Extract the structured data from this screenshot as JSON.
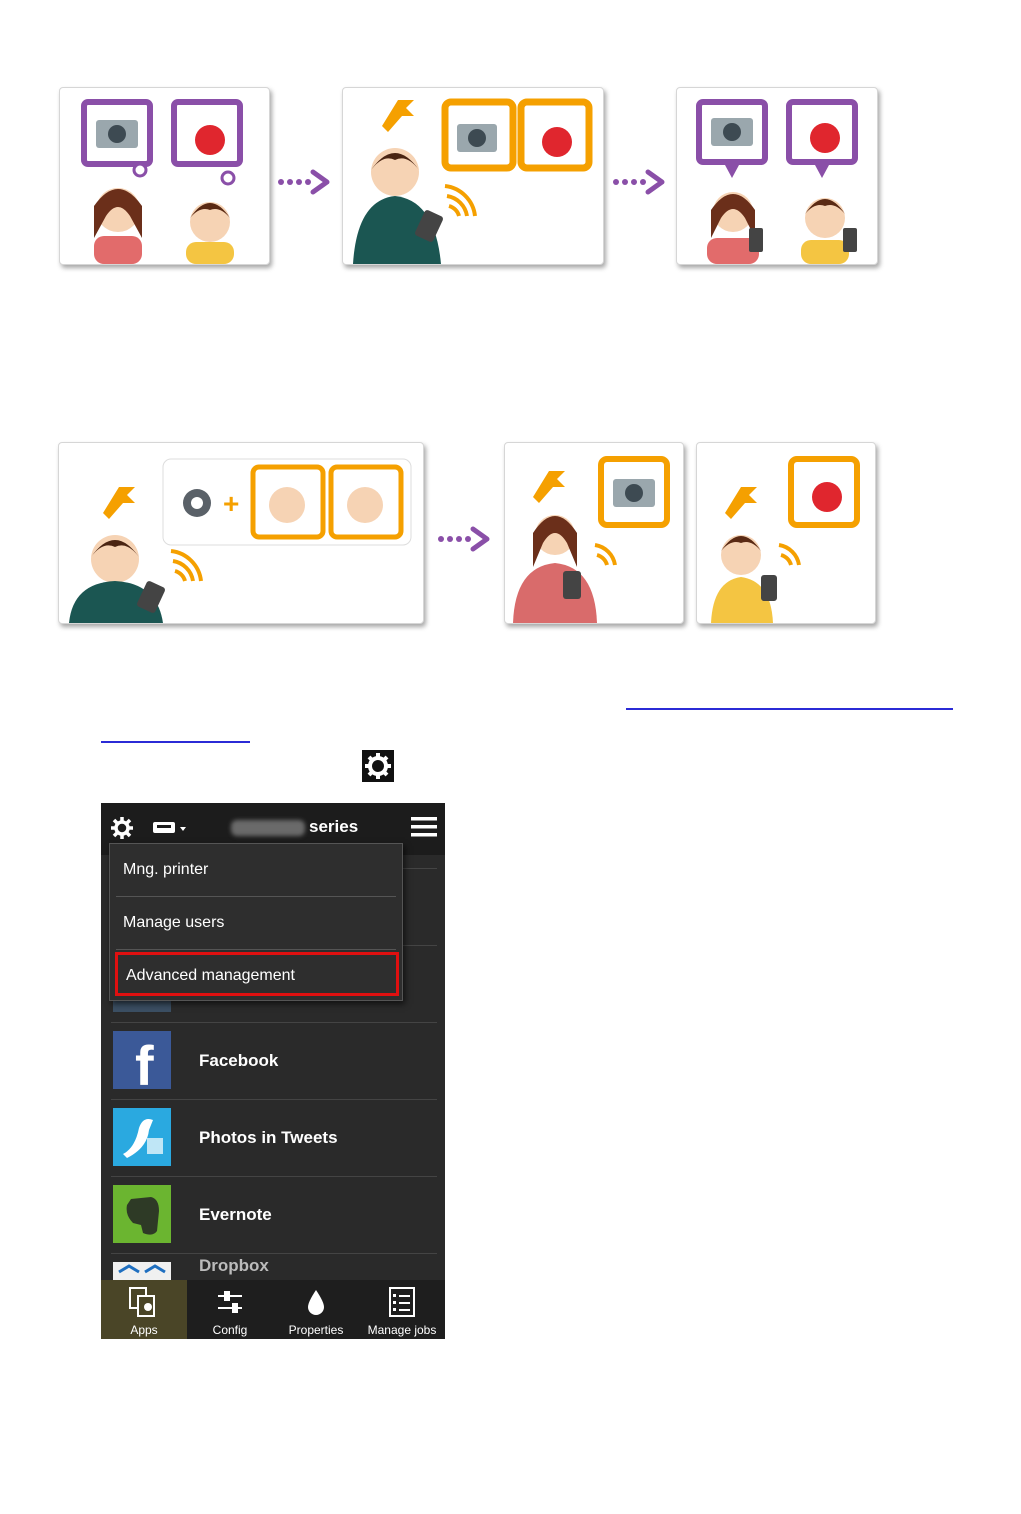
{
  "phone": {
    "title_suffix": "series",
    "menu": {
      "items": [
        {
          "label": "Mng. printer"
        },
        {
          "label": "Manage users"
        },
        {
          "label": "Advanced management"
        }
      ]
    },
    "apps": [
      {
        "name": "Facebook",
        "icon": "facebook-icon"
      },
      {
        "name": "Photos in Tweets",
        "icon": "twitter-bird-icon"
      },
      {
        "name": "Evernote",
        "icon": "evernote-icon"
      },
      {
        "name": "Dropbox",
        "icon": "dropbox-icon"
      }
    ],
    "bottom_tabs": [
      {
        "label": "Apps",
        "icon": "apps-icon"
      },
      {
        "label": "Config",
        "icon": "sliders-icon"
      },
      {
        "label": "Properties",
        "icon": "ink-drop-icon"
      },
      {
        "label": "Manage jobs",
        "icon": "jobs-list-icon"
      }
    ]
  },
  "colors": {
    "purple": "#8a4fa8",
    "orange": "#f5a000",
    "highlight_red": "#e01010",
    "link_blue": "#2b2bd6"
  }
}
